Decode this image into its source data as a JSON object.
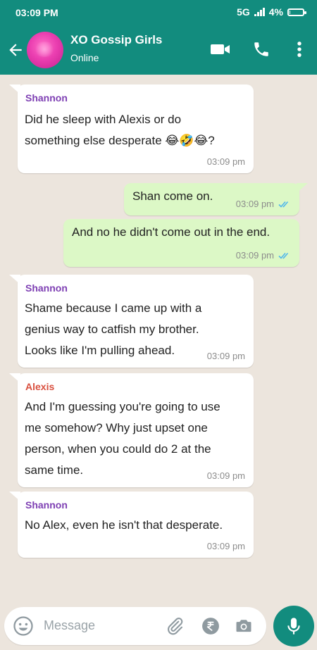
{
  "status_bar": {
    "time": "03:09 PM",
    "network": "5G",
    "battery": "4%",
    "battery_level": 0.04
  },
  "header": {
    "title": "XO Gossip Girls",
    "subtitle": "Online"
  },
  "colors": {
    "header": "#128c7e",
    "background": "#ece5dd",
    "outgoing_bubble": "#dcf8c6",
    "sender_shannon": "#7e3fb3",
    "sender_alexis": "#d9503f",
    "read_ticks": "#4fb6ec"
  },
  "messages": [
    {
      "sender": "Shannon",
      "text": "Did he sleep with Alexis or do\nsomething else desperate 😂🤣😂?",
      "time": "03:09 pm"
    },
    {
      "text": "Shan come on.",
      "time": "03:09 pm",
      "status": "read"
    },
    {
      "text": "And no he didn't come out in the end.",
      "time": "03:09 pm",
      "status": "read"
    },
    {
      "sender": "Shannon",
      "text": "Shame because I came up with a\ngenius way to catfish my brother.\nLooks like I'm pulling ahead.",
      "time": "03:09 pm"
    },
    {
      "sender": "Alexis",
      "text": "And I'm guessing you're going to use\nme somehow? Why just upset one\nperson, when you could do 2 at the\nsame time.",
      "time": "03:09 pm"
    },
    {
      "sender": "Shannon",
      "text": "No Alex, even he isn't that desperate.",
      "time": "03:09 pm"
    }
  ],
  "composer": {
    "placeholder": "Message"
  },
  "icons": [
    "back-arrow-icon",
    "video-call-icon",
    "voice-call-icon",
    "more-options-icon",
    "emoji-icon",
    "attach-icon",
    "rupee-payment-icon",
    "camera-icon",
    "mic-icon",
    "double-check-icon"
  ]
}
